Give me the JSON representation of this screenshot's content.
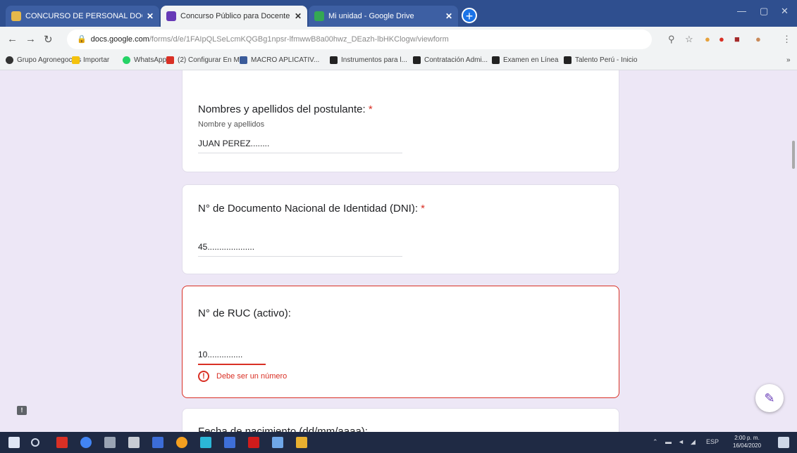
{
  "browser": {
    "tabs": [
      {
        "title": "CONCURSO DE PERSONAL DOC"
      },
      {
        "title": "Concurso Público para Docente"
      },
      {
        "title": "Mi unidad - Google Drive"
      }
    ],
    "new_tab_label": "+",
    "url_host": "docs.google.com",
    "url_path": "/forms/d/e/1FAIpQLSeLcmKQGBg1npsr-lfmwwB8a00hwz_DEazh-lbHKClogw/viewform",
    "bookmarks": [
      "Grupo Agronegocios",
      "Importar",
      "WhatsApp",
      "(2) Configurar En M...",
      "MACRO APLICATIV...",
      "Instrumentos para l...",
      "Contratación Admi...",
      "Examen en Línea",
      "Talento Perú - Inicio"
    ],
    "bookmarks_more": "»"
  },
  "form": {
    "q1": {
      "title": "Nombres y apellidos del postulante:",
      "required_mark": "*",
      "description": "Nombre y apellidos",
      "answer": "JUAN PEREZ........"
    },
    "q2": {
      "title": "N° de Documento Nacional de Identidad (DNI):",
      "required_mark": "*",
      "answer": "45...................."
    },
    "q3": {
      "title": "N° de RUC (activo):",
      "answer": "10...............",
      "error": "Debe ser un número"
    },
    "q4": {
      "title": "Fecha de nacimiento (dd/mm/aaaa):"
    },
    "edit_fab_label": "✎",
    "feedback_label": "!"
  },
  "taskbar": {
    "tray_text": "ESP",
    "time": "2:00 p. m.",
    "date": "16/04/2020"
  }
}
